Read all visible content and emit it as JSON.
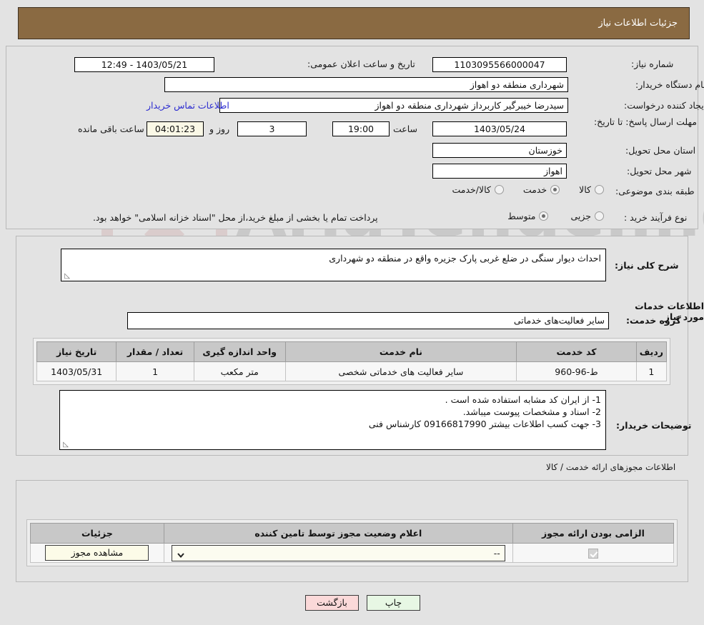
{
  "header": {
    "title": "جزئیات اطلاعات نیاز"
  },
  "fields": {
    "need_number_label": "شماره نیاز:",
    "need_number_value": "1103095566000047",
    "announce_label": "تاریخ و ساعت اعلان عمومی:",
    "announce_value": "1403/05/21 - 12:49",
    "buyer_org_label": "نام دستگاه خریدار:",
    "buyer_org_value": "شهرداری منطقه دو اهواز",
    "creator_label": "ایجاد کننده درخواست:",
    "creator_value": "سیدرضا خیبرگیر کاربرداز  شهرداری منطقه دو اهواز",
    "contact_link": "اطلاعات تماس خریدار",
    "deadline_label": "مهلت ارسال پاسخ: تا تاریخ:",
    "deadline_date": "1403/05/24",
    "deadline_hour_label": "ساعت",
    "deadline_hour": "19:00",
    "days_left": "3",
    "days_word": "روز و",
    "time_left": "04:01:23",
    "time_left_word": "ساعت باقی مانده",
    "province_label": "استان محل تحویل:",
    "province_value": "خوزستان",
    "city_label": "شهر محل تحویل:",
    "city_value": "اهواز",
    "category_label": "طبقه بندی موضوعی:",
    "purchase_type_label": "نوع فرآیند خرید :",
    "payment_note": "پرداخت تمام یا بخشی از مبلغ خرید،از محل \"اسناد خزانه اسلامی\" خواهد بود."
  },
  "category_options": [
    {
      "label": "کالا",
      "selected": false
    },
    {
      "label": "خدمت",
      "selected": true
    },
    {
      "label": "کالا/خدمت",
      "selected": false
    }
  ],
  "purchase_options": [
    {
      "label": "جزیی",
      "selected": false
    },
    {
      "label": "متوسط",
      "selected": true
    }
  ],
  "description": {
    "label": "شرح کلی نیاز:",
    "value": "احداث دیوار سنگی در ضلع غربی پارک جزیره واقع در منطقه دو شهرداری"
  },
  "services_section": {
    "heading": "اطلاعات خدمات مورد نیاز",
    "group_label": "گروه خدمت:",
    "group_value": "سایر فعالیت‌های خدماتی"
  },
  "services_table": {
    "headers": [
      "ردیف",
      "کد خدمت",
      "نام خدمت",
      "واحد اندازه گیری",
      "تعداد / مقدار",
      "تاریخ نیاز"
    ],
    "rows": [
      {
        "row_no": "1",
        "service_code": "ط-96-960",
        "service_name": "سایر فعالیت های خدماتی شخصی",
        "unit": "متر مکعب",
        "quantity": "1",
        "need_date": "1403/05/31"
      }
    ]
  },
  "buyer_notes": {
    "label": "توضیحات خریدار:",
    "lines": [
      "1- از ایران کد مشابه استفاده شده است .",
      "2- اسناد و مشخصات پیوست میباشد.",
      "3- جهت کسب اطلاعات بیشتر 09166817990 کارشناس فنی"
    ]
  },
  "permits_section": {
    "heading": "اطلاعات مجوزهای ارائه خدمت / کالا",
    "headers": [
      "الزامی بودن ارائه مجوز",
      "اعلام وضعیت مجوز توسط تامین کننده",
      "جزئیات"
    ],
    "rows": [
      {
        "required_checked": true,
        "status_value": "--",
        "details_button": "مشاهده مجوز"
      }
    ]
  },
  "footer": {
    "print_button": "چاپ",
    "back_button": "بازگشت"
  },
  "watermark": {
    "text": "AriaTender.net"
  },
  "colors": {
    "header_bg": "#8a6a42",
    "page_bg": "#e3e3e3",
    "link": "#2b2bd0",
    "table_header_bg": "#c8c8c8",
    "beige_field": "#faf8e6",
    "back_button_bg": "#fbd9d9",
    "print_button_bg": "#e7f7e4"
  }
}
